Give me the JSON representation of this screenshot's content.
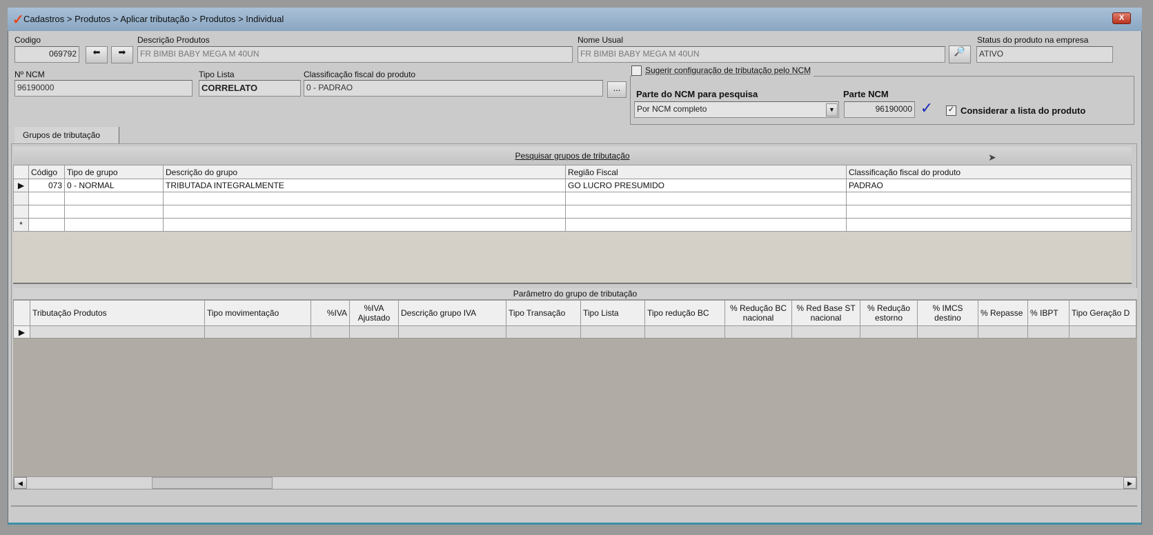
{
  "window": {
    "title": "Cadastros > Produtos > Aplicar tributação > Produtos > Individual",
    "close_label": "X",
    "accent": "#e2481c"
  },
  "form": {
    "codigo_label": "Codigo",
    "codigo_value": "069792",
    "descricao_label": "Descrição  Produtos",
    "descricao_value": "FR BIMBI BABY MEGA M 40UN",
    "nome_usual_label": "Nome Usual",
    "nome_usual_value": "FR BIMBI BABY MEGA M 40UN",
    "status_label": "Status do produto na empresa",
    "status_value": "ATIVO",
    "ncm_label": "Nº NCM",
    "ncm_value": "96190000",
    "tipo_lista_label": "Tipo Lista",
    "tipo_lista_value": "CORRELATO",
    "classificacao_label": "Classificação fiscal do produto",
    "classificacao_value": "0 - PADRAO",
    "ellipsis": "...",
    "sugerir_label": "Sugerir configuração de tributação pelo NCM",
    "sugerir_checked": false,
    "parte_ncm_pesquisa_label": "Parte do NCM para pesquisa",
    "parte_ncm_pesquisa_value": "Por NCM completo",
    "parte_ncm_label": "Parte NCM",
    "parte_ncm_value": "96190000",
    "considerar_label": "Considerar a lista do produto",
    "considerar_checked": true
  },
  "tabs": [
    {
      "label": "Grupos de tributação"
    }
  ],
  "groups": {
    "search_label": "Pesquisar grupos de tributação",
    "columns": [
      "Código",
      "Tipo de grupo",
      "Descrição do grupo",
      "Região Fiscal",
      "Classificação fiscal do produto"
    ],
    "rows": [
      [
        "073",
        "0 - NORMAL",
        "TRIBUTADA INTEGRALMENTE",
        "GO LUCRO PRESUMIDO",
        "PADRAO"
      ]
    ],
    "new_row_marker": "*"
  },
  "params": {
    "title": "Parâmetro do grupo de tributação",
    "columns": [
      "Tributação Produtos",
      "Tipo movimentação",
      "%IVA",
      "%IVA Ajustado",
      "Descrição grupo IVA",
      "Tipo Transação",
      "Tipo Lista",
      "Tipo redução BC",
      "% Redução BC nacional",
      "% Red Base ST nacional",
      "% Redução estorno",
      "% IMCS destino",
      "% Repasse",
      "% IBPT",
      "Tipo Geração D"
    ]
  }
}
